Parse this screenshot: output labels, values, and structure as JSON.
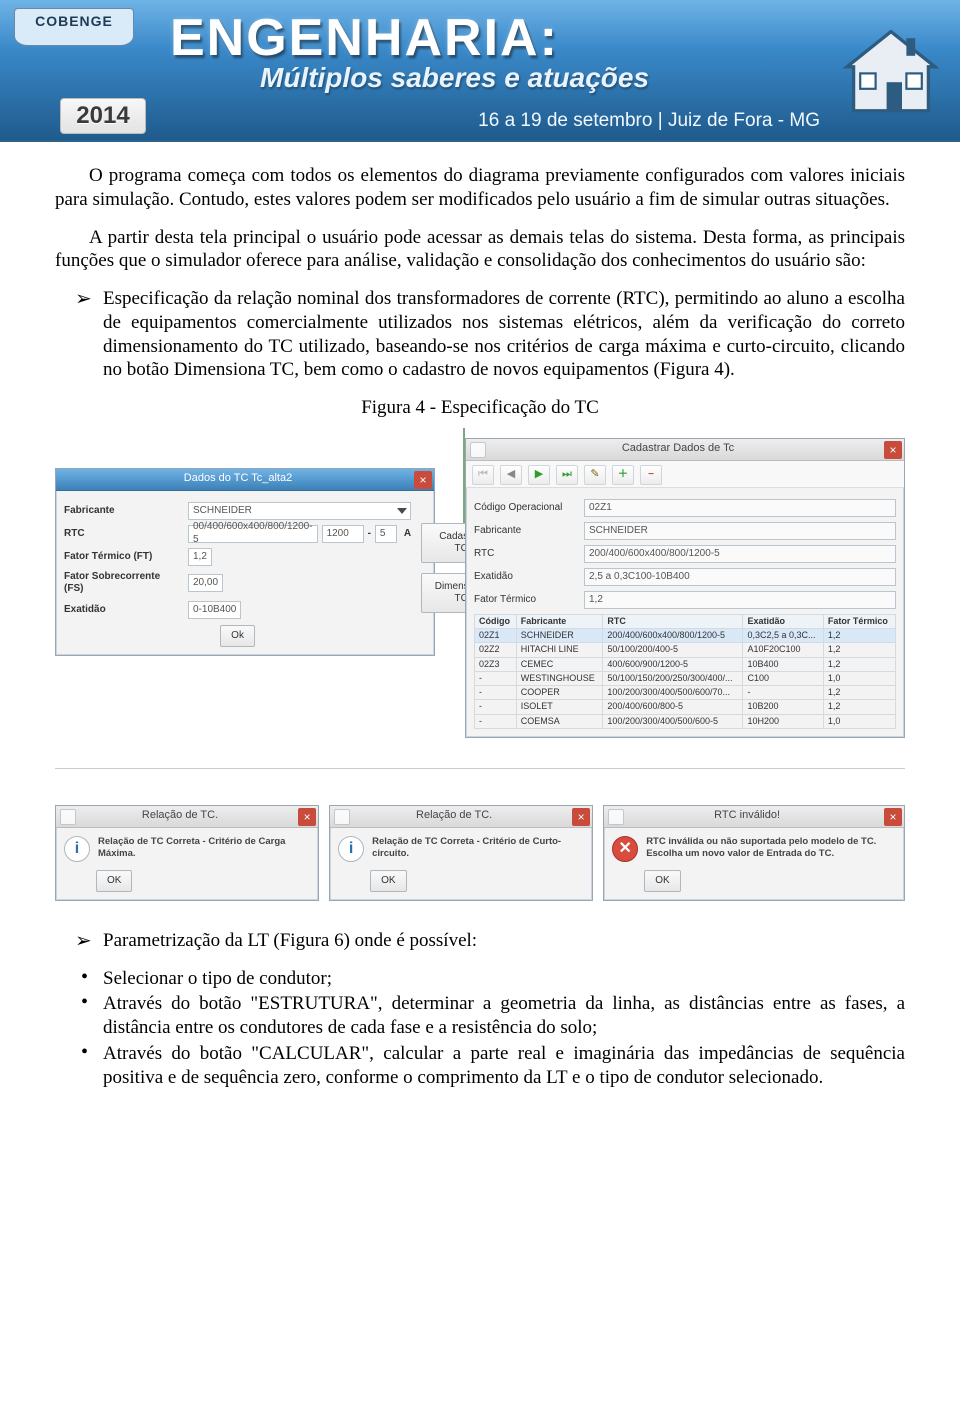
{
  "banner": {
    "badge": "COBENGE",
    "year": "2014",
    "title": "ENGENHARIA:",
    "subtitle": "Múltiplos saberes e atuações",
    "dateline": "16 a 19 de setembro | Juiz de Fora - MG"
  },
  "paragraphs": {
    "p1": "O programa começa com todos os elementos do diagrama previamente configurados com valores iniciais para simulação. Contudo, estes valores podem ser modificados pelo usuário a fim de simular outras situações.",
    "p2": "A partir desta tela principal o usuário pode acessar as demais telas do sistema. Desta forma, as principais funções que o simulador oferece para análise, validação e consolidação dos conhecimentos do usuário são:",
    "bullet1": "Especificação da relação nominal dos transformadores de corrente (RTC), permitindo ao aluno a escolha de equipamentos comercialmente utilizados nos sistemas elétricos, além da verificação do correto dimensionamento do TC utilizado, baseando-se nos critérios de carga máxima e curto-circuito, clicando no botão Dimensiona TC, bem como o cadastro de novos equipamentos (Figura 4).",
    "figcaption": "Figura 4 - Especificação do TC",
    "lt_head": "Parametrização da LT (Figura 6) onde é possível:",
    "lt_i1": "Selecionar o tipo de condutor;",
    "lt_i2": "Através do botão \"ESTRUTURA\", determinar a geometria da linha, as distâncias entre as fases, a distância entre os condutores de cada fase e a resistência do solo;",
    "lt_i3": "Através do botão \"CALCULAR\", calcular a parte real e imaginária das impedâncias de sequência positiva e de sequência zero, conforme o comprimento da LT e o tipo de condutor selecionado."
  },
  "win1": {
    "title": "Dados do TC Tc_alta2",
    "labels": {
      "fabricante": "Fabricante",
      "rtc": "RTC",
      "ft": "Fator Térmico (FT)",
      "fs": "Fator Sobrecorrente (FS)",
      "exatidao": "Exatidão"
    },
    "values": {
      "fabricante": "SCHNEIDER",
      "rtc_full": "00/400/600x400/800/1200-5",
      "rtc_prim": "1200",
      "rtc_sec": "5",
      "unitA": "A",
      "ft": "1,2",
      "fs": "20,00",
      "exatidao": "0-10B400"
    },
    "buttons": {
      "ok": "Ok",
      "cadastrar": "Cadastrar\nTC",
      "dimensiona": "Dimensiona\nTC"
    }
  },
  "win2": {
    "title": "Cadastrar Dados de Tc",
    "labels": {
      "codigo": "Código Operacional",
      "fabricante": "Fabricante",
      "rtc": "RTC",
      "exatidao": "Exatidão",
      "ft": "Fator Térmico"
    },
    "values": {
      "codigo": "02Z1",
      "fabricante": "SCHNEIDER",
      "rtc": "200/400/600x400/800/1200-5",
      "exatidao": "2,5 a 0,3C100-10B400",
      "ft": "1,2"
    },
    "columns": [
      "Código",
      "Fabricante",
      "RTC",
      "Exatidão",
      "Fator Térmico"
    ],
    "rows": [
      {
        "sel": true,
        "c": [
          "02Z1",
          "SCHNEIDER",
          "200/400/600x400/800/1200-5",
          "0,3C2,5 a 0,3C...",
          "1,2"
        ]
      },
      {
        "sel": false,
        "c": [
          "02Z2",
          "HITACHI LINE",
          "50/100/200/400-5",
          "A10F20C100",
          "1,2"
        ]
      },
      {
        "sel": false,
        "c": [
          "02Z3",
          "CEMEC",
          "400/600/900/1200-5",
          "10B400",
          "1,2"
        ]
      },
      {
        "sel": false,
        "c": [
          "-",
          "WESTINGHOUSE",
          "50/100/150/200/250/300/400/...",
          "C100",
          "1,0"
        ]
      },
      {
        "sel": false,
        "c": [
          "-",
          "COOPER",
          "100/200/300/400/500/600/70...",
          "-",
          "1,2"
        ]
      },
      {
        "sel": false,
        "c": [
          "-",
          "ISOLET",
          "200/400/600/800-5",
          "10B200",
          "1,2"
        ]
      },
      {
        "sel": false,
        "c": [
          "-",
          "COEMSA",
          "100/200/300/400/500/600-5",
          "10H200",
          "1,0"
        ]
      }
    ]
  },
  "msgs": {
    "m1": {
      "title": "Relação de TC.",
      "text": "Relação de TC Correta - Critério de Carga Máxima.",
      "ok": "OK"
    },
    "m2": {
      "title": "Relação de TC.",
      "text": "Relação de TC Correta - Critério de Curto-circuito.",
      "ok": "OK"
    },
    "m3": {
      "title": "RTC inválido!",
      "text": "RTC inválida ou não suportada pelo modelo de TC. Escolha um novo valor de Entrada do TC.",
      "ok": "OK"
    }
  }
}
